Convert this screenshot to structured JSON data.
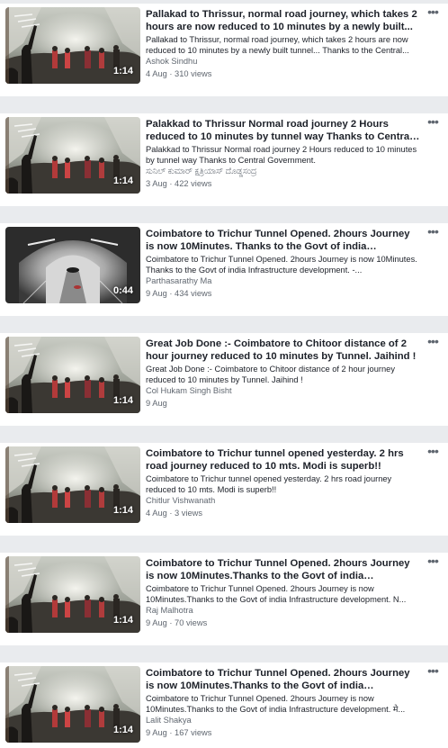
{
  "icons": {
    "more": "more-horizontal-icon"
  },
  "videos": [
    {
      "title": "Pallakad to Thrissur, normal road journey, which takes 2 hours are now reduced to 10 minutes by a newly built...",
      "description": "Pallakad to Thrissur, normal road journey, which takes 2 hours are now reduced to 10 minutes by a newly built tunnel... Thanks to the Central...",
      "author": "Ashok Sindhu",
      "meta": "4 Aug · 310 views",
      "duration": "1:14",
      "thumbnail": "crowd"
    },
    {
      "title": "Palakkad to Thrissur Normal road journey 2 Hours reduced to 10 minutes by tunnel way Thanks to Central Government.",
      "description": "Palakkad to Thrissur Normal road journey 2 Hours reduced to 10 minutes by tunnel way Thanks to Central Government.",
      "author": "ಸುನಿಲ್ ಕುಮಾರ್ ಕ್ಷತ್ರಿಯಾಸ್ ದೊಡ್ಡಸಂದ್ರ",
      "meta": "3 Aug · 422 views",
      "duration": "1:14",
      "thumbnail": "crowd"
    },
    {
      "title": "Coimbatore to Trichur Tunnel Opened. 2hours Journey is now 10Minutes. Thanks to the Govt of india Infrastructure...",
      "description": "Coimbatore to Trichur Tunnel Opened. 2hours Journey is now 10Minutes. Thanks to the Govt of india Infrastructure development. -...",
      "author": "Parthasarathy Ma",
      "meta": "9 Aug · 434 views",
      "duration": "0:44",
      "thumbnail": "tunnel"
    },
    {
      "title": "Great Job Done :- Coimbatore to Chitoor distance of 2 hour journey reduced to 10 minutes by Tunnel. Jaihind !",
      "description": "Great Job Done :- Coimbatore to Chitoor distance of 2 hour journey reduced to 10 minutes by Tunnel. Jaihind !",
      "author": "Col Hukam Singh Bisht",
      "meta": "9 Aug",
      "duration": "1:14",
      "thumbnail": "crowd"
    },
    {
      "title": "Coimbatore to Trichur tunnel opened yesterday. 2 hrs road journey reduced to 10 mts. Modi is superb!!",
      "description": "Coimbatore to Trichur tunnel opened yesterday. 2 hrs road journey reduced to 10 mts. Modi is superb!!",
      "author": "Chitlur Vishwanath",
      "meta": "4 Aug · 3 views",
      "duration": "1:14",
      "thumbnail": "crowd"
    },
    {
      "title": "Coimbatore to Trichur Tunnel Opened. 2hours Journey is now 10Minutes.Thanks to the Govt of india Infrastructure...",
      "description": "Coimbatore to Trichur Tunnel Opened. 2hours Journey is now 10Minutes.Thanks to the Govt of india Infrastructure development. N...",
      "author": "Raj Malhotra",
      "meta": "9 Aug · 70 views",
      "duration": "1:14",
      "thumbnail": "crowd"
    },
    {
      "title": "Coimbatore to Trichur Tunnel Opened. 2hours Journey is now 10Minutes.Thanks to the Govt of india Infrastructure...",
      "description": "Coimbatore to Trichur Tunnel Opened. 2hours Journey is now 10Minutes.Thanks to the Govt of india Infrastructure development. मे...",
      "author": "Lalit Shakya",
      "meta": "9 Aug · 167 views",
      "duration": "1:14",
      "thumbnail": "crowd"
    }
  ]
}
